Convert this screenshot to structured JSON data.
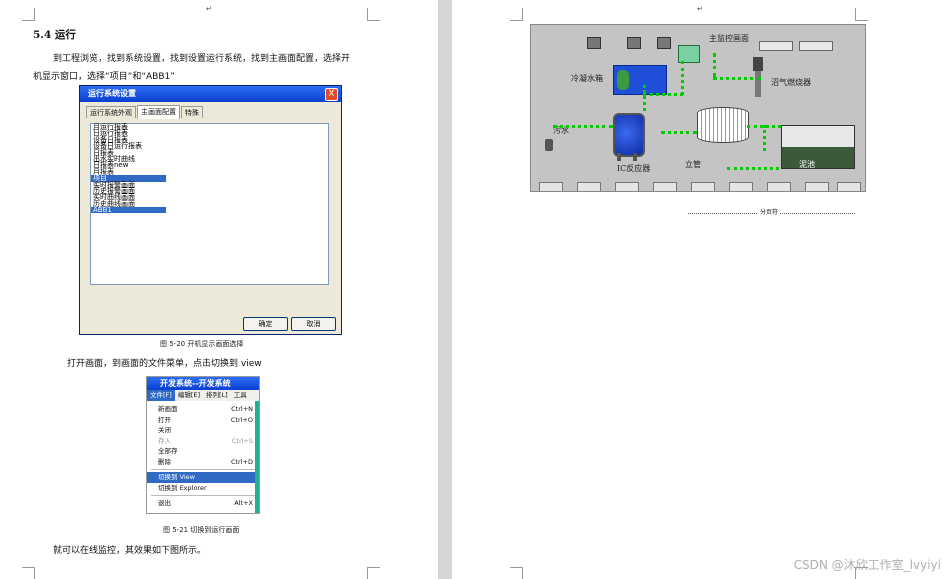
{
  "left_page": {
    "heading": "5.4 运行",
    "para1_line1": "到工程浏览，找到系统设置，找到设置运行系统，找到主画面配置，选择开",
    "para1_line2": "机显示窗口，选择“项目”和“ABB1”",
    "dialog": {
      "title": "运行系统设置",
      "close": "X",
      "tabs": [
        "运行系统外观",
        "主画面配置",
        "特殊"
      ],
      "items": [
        "月运行报表",
        "日运行报表",
        "设备日报表",
        "设备日运行报表",
        "日报表",
        "出水实时曲线",
        "日报表new",
        "月报表",
        "项目",
        "实时报警画面",
        "历史报警画面",
        "实时曲线画面",
        "历史曲线画面",
        "ABB1"
      ],
      "selected": [
        "项目",
        "ABB1"
      ],
      "ok": "确定",
      "cancel": "取消"
    },
    "caption1": "图 5-20 开机显示画面选择",
    "para2": "打开画面，到画面的文件菜单，点击切换到 view",
    "menu": {
      "title": "开发系统--开发系统",
      "bar": [
        "文件[F]",
        "编辑[E]",
        "排列[L]",
        "工具"
      ],
      "items": [
        {
          "label": "新画面",
          "shortcut": "Ctrl+N"
        },
        {
          "label": "打开",
          "shortcut": "Ctrl+O"
        },
        {
          "label": "关闭",
          "shortcut": ""
        },
        {
          "label": "存入",
          "shortcut": "Ctrl+S"
        },
        {
          "label": "全部存",
          "shortcut": ""
        },
        {
          "label": "删除",
          "shortcut": "Ctrl+D"
        },
        {
          "label": "切换到 View",
          "shortcut": ""
        },
        {
          "label": "切换到 Explorer",
          "shortcut": ""
        },
        {
          "label": "退出",
          "shortcut": "Alt+X"
        }
      ]
    },
    "caption2": "图 5-21 切换到运行画面",
    "para3": "就可以在线监控，其效果如下图所示。"
  },
  "right_page": {
    "hmi": {
      "main_title": "主监控画面",
      "labels": {
        "cold_water_tank": "冷凝水箱",
        "biogas_burner": "沼气燃烧器",
        "sewage": "污水",
        "ic_reactor": "IC反应器",
        "standpipe": "立管",
        "sludge_pool": "泥池"
      }
    },
    "page_break": "分页符"
  },
  "watermark": "CSDN @沐欣工作室_lvyiyi",
  "colors": {
    "highlight": "#316ac5",
    "pipe": "#00cc00",
    "tank_blue": "#1f4fd8"
  }
}
